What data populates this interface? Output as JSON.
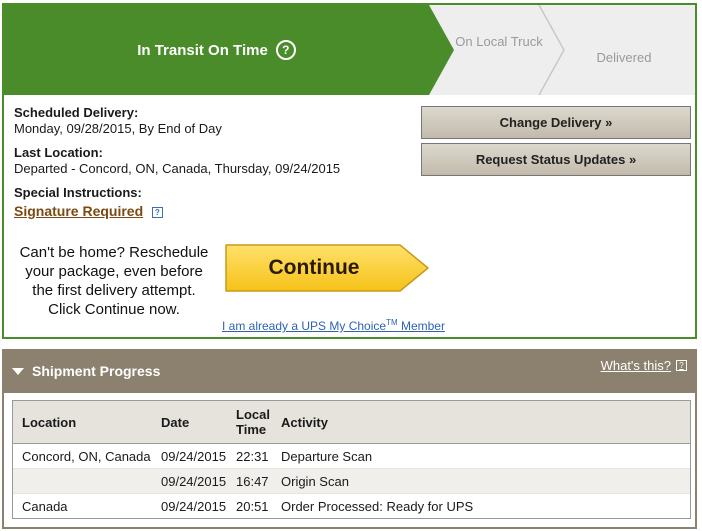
{
  "progress": {
    "active_step": "In Transit On Time",
    "help_icon": "?",
    "step2": "On Local Truck",
    "step3": "Delivered",
    "colors": {
      "active": "#4a8c2a",
      "inactive": "#eeeeee"
    }
  },
  "details": {
    "scheduled_label": "Scheduled Delivery:",
    "scheduled_value": "Monday, 09/28/2015, By End of Day",
    "last_location_label": "Last Location:",
    "last_location_value": "Departed - Concord, ON, Canada, Thursday, 09/24/2015",
    "special_label": "Special Instructions:",
    "special_value": "Signature Required",
    "info_icon": "?"
  },
  "actions": {
    "change_delivery": "Change Delivery »",
    "request_updates": "Request Status Updates »"
  },
  "reschedule": {
    "text": "Can't be home? Reschedule your package, even before the first delivery attempt. Click Continue now.",
    "continue_label": "Continue",
    "member_link_pre": "I am already a UPS My Choice",
    "member_link_tm": "TM",
    "member_link_post": " Member"
  },
  "shipment": {
    "title": "Shipment Progress",
    "whats_this": "What's this?",
    "columns": [
      "Location",
      "Date",
      "Local Time",
      "Activity"
    ],
    "rows": [
      {
        "location": "Concord, ON, Canada",
        "date": "09/24/2015",
        "time": "22:31",
        "activity": "Departure Scan"
      },
      {
        "location": "",
        "date": "09/24/2015",
        "time": "16:47",
        "activity": "Origin Scan"
      },
      {
        "location": "Canada",
        "date": "09/24/2015",
        "time": "20:51",
        "activity": "Order Processed: Ready for UPS"
      }
    ]
  }
}
